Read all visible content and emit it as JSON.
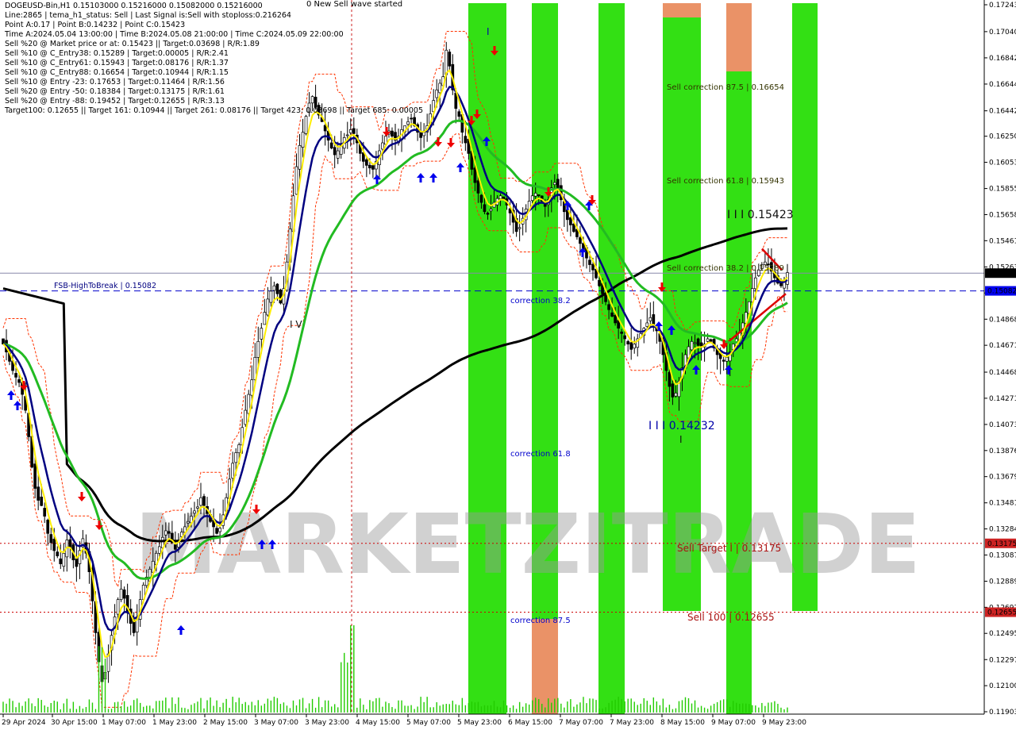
{
  "header": {
    "symbol_line": "DOGEUSD-Bin,H1  0.15103000 0.15216000 0.15082000 0.15216000",
    "lines": [
      "Line:2865 | tema_h1_status: Sell | Last Signal is:Sell with stoploss:0.216264",
      "Point A:0.17 | Point B:0.14232 | Point C:0.15423",
      "Time A:2024.05.04 13:00:00 | Time B:2024.05.08 21:00:00 | Time C:2024.05.09 22:00:00",
      "Sell %20 @ Market price or at: 0.15423 || Target:0.03698 | R/R:1.89",
      "Sell %10 @ C_Entry38: 0.15289 | Target:0.00005 | R/R:2.41",
      "Sell %10 @ C_Entry61: 0.15943 | Target:0.08176 | R/R:1.37",
      "Sell %10 @ C_Entry88: 0.16654 | Target:0.10944 | R/R:1.15",
      "Sell %10 @ Entry -23: 0.17653 | Target:0.11464 | R/R:1.56",
      "Sell %20 @ Entry -50: 0.18384 | Target:0.13175 | R/R:1.61",
      "Sell %20 @ Entry -88: 0.19452 | Target:0.12655 | R/R:3.13",
      "Target100: 0.12655 || Target 161: 0.10944 || Target 261: 0.08176 || Target 423: 0.03698 || Target 685: 0.00005"
    ],
    "top_note": "0 New Sell wave started"
  },
  "annotations": {
    "fsb_label": "FSB-HighToBreak | 0.15082",
    "sell_corr_875": "Sell correction 87.5 | 0.16654",
    "sell_corr_618": "Sell correction 61.8 | 0.15943",
    "sell_corr_382": "Sell correction 38.2 | 0.15289",
    "point_c": "I I I 0.15423",
    "point_b": "I I I 0.14232",
    "corr_382": "correction 38.2",
    "corr_618": "correction 61.8",
    "corr_875": "correction 87.5",
    "sell_target": "Sell Target I | 0.13175",
    "sell_100": "Sell 100 | 0.12655",
    "wave_iv": "I V",
    "wave_i_top": "I",
    "wave_i_bottom": "I",
    "watermark": "MARKETZITRADE"
  },
  "colors": {
    "green_band": "#22dd00",
    "orange_band": "#e8895a",
    "ma_black": "#000000",
    "ma_green": "#22bb22",
    "ma_navy": "#000080",
    "ma_yellow": "#ffee00",
    "envelope": "#ff3300",
    "dashed_blue": "#0000cc",
    "dotted_red": "#cc0000",
    "price_tag_current": "#000000",
    "price_tag_blue": "#0000ee",
    "price_tag_red": "#cc2222"
  },
  "price_axis": {
    "ticks": [
      "0.17243",
      "0.17040",
      "0.16842",
      "0.16644",
      "0.16442",
      "0.16250",
      "0.16053",
      "0.15855",
      "0.15658",
      "0.15461",
      "0.15263",
      "0.15066",
      "0.14868",
      "0.14671",
      "0.14468",
      "0.14271",
      "0.14073",
      "0.13876",
      "0.13679",
      "0.13481",
      "0.13284",
      "0.13087",
      "0.12889",
      "0.12692",
      "0.12495",
      "0.12297",
      "0.12100",
      "0.11903"
    ],
    "tags": [
      {
        "label": "0.15216",
        "color": "#000000"
      },
      {
        "label": "0.15082",
        "color": "#0000ee"
      },
      {
        "label": "0.13175",
        "color": "#cc2222"
      },
      {
        "label": "0.12655",
        "color": "#cc2222"
      }
    ]
  },
  "time_axis": {
    "labels": [
      "29 Apr 2024",
      "30 Apr 15:00",
      "1 May 07:00",
      "1 May 23:00",
      "2 May 15:00",
      "3 May 07:00",
      "3 May 23:00",
      "4 May 15:00",
      "5 May 07:00",
      "5 May 23:00",
      "6 May 15:00",
      "7 May 07:00",
      "7 May 23:00",
      "8 May 15:00",
      "9 May 07:00",
      "9 May 23:00"
    ]
  },
  "chart_data": {
    "type": "candlestick",
    "title": "DOGEUSD-Bin,H1",
    "ylim": [
      0.11903,
      0.17243
    ],
    "closes": [
      0.1468,
      0.1462,
      0.1455,
      0.1448,
      0.1443,
      0.1439,
      0.143,
      0.1418,
      0.1398,
      0.1375,
      0.1359,
      0.135,
      0.1346,
      0.1338,
      0.1325,
      0.1318,
      0.1312,
      0.1308,
      0.1302,
      0.131,
      0.132,
      0.1314,
      0.1305,
      0.13,
      0.1312,
      0.1321,
      0.131,
      0.1296,
      0.1274,
      0.125,
      0.1228,
      0.1213,
      0.122,
      0.1234,
      0.1248,
      0.1262,
      0.1275,
      0.1283,
      0.1276,
      0.1265,
      0.1257,
      0.125,
      0.1262,
      0.1275,
      0.1286,
      0.1292,
      0.1298,
      0.1304,
      0.131,
      0.1315,
      0.1322,
      0.1327,
      0.1325,
      0.1318,
      0.1313,
      0.132,
      0.1326,
      0.133,
      0.1334,
      0.1338,
      0.1342,
      0.1345,
      0.1352,
      0.1346,
      0.134,
      0.1334,
      0.133,
      0.1325,
      0.1329,
      0.1339,
      0.1352,
      0.1366,
      0.1378,
      0.1386,
      0.1392,
      0.1405,
      0.1418,
      0.143,
      0.1441,
      0.1458,
      0.147,
      0.148,
      0.1492,
      0.1502,
      0.1508,
      0.1512,
      0.1506,
      0.1499,
      0.151,
      0.153,
      0.1555,
      0.158,
      0.1602,
      0.1618,
      0.1628,
      0.164,
      0.165,
      0.1655,
      0.1647,
      0.1641,
      0.1636,
      0.1629,
      0.1622,
      0.1616,
      0.1611,
      0.1614,
      0.1618,
      0.1624,
      0.1626,
      0.163,
      0.1627,
      0.162,
      0.1612,
      0.1606,
      0.1603,
      0.1601,
      0.16,
      0.1606,
      0.1614,
      0.162,
      0.1625,
      0.1629,
      0.1625,
      0.1622,
      0.1625,
      0.163,
      0.1633,
      0.1636,
      0.1638,
      0.1633,
      0.1628,
      0.1624,
      0.1628,
      0.1633,
      0.1642,
      0.1652,
      0.166,
      0.1665,
      0.167,
      0.169,
      0.1678,
      0.166,
      0.1646,
      0.164,
      0.1628,
      0.162,
      0.1612,
      0.16,
      0.159,
      0.1582,
      0.1575,
      0.1568,
      0.1566,
      0.157,
      0.1575,
      0.1578,
      0.158,
      0.1577,
      0.1573,
      0.1567,
      0.156,
      0.1553,
      0.1556,
      0.1563,
      0.157,
      0.1576,
      0.158,
      0.1582,
      0.158,
      0.1576,
      0.1572,
      0.1577,
      0.1586,
      0.159,
      0.1586,
      0.1577,
      0.1568,
      0.1562,
      0.1558,
      0.1553,
      0.1549,
      0.1544,
      0.1538,
      0.1533,
      0.1528,
      0.1524,
      0.1518,
      0.1512,
      0.1506,
      0.15,
      0.1494,
      0.1489,
      0.1484,
      0.148,
      0.1476,
      0.1472,
      0.1468,
      0.1464,
      0.1468,
      0.1472,
      0.1476,
      0.148,
      0.1484,
      0.1488,
      0.1483,
      0.1478,
      0.147,
      0.146,
      0.1448,
      0.1436,
      0.1428,
      0.1431,
      0.144,
      0.145,
      0.146,
      0.1466,
      0.147,
      0.1469,
      0.1467,
      0.1466,
      0.1468,
      0.1472,
      0.147,
      0.1465,
      0.146,
      0.1457,
      0.1455,
      0.1458,
      0.1462,
      0.1468,
      0.1472,
      0.1477,
      0.1484,
      0.1492,
      0.15,
      0.151,
      0.1518,
      0.1524,
      0.1528,
      0.153,
      0.1528,
      0.1523,
      0.1518,
      0.1514,
      0.1512,
      0.1516,
      0.1522
    ]
  }
}
